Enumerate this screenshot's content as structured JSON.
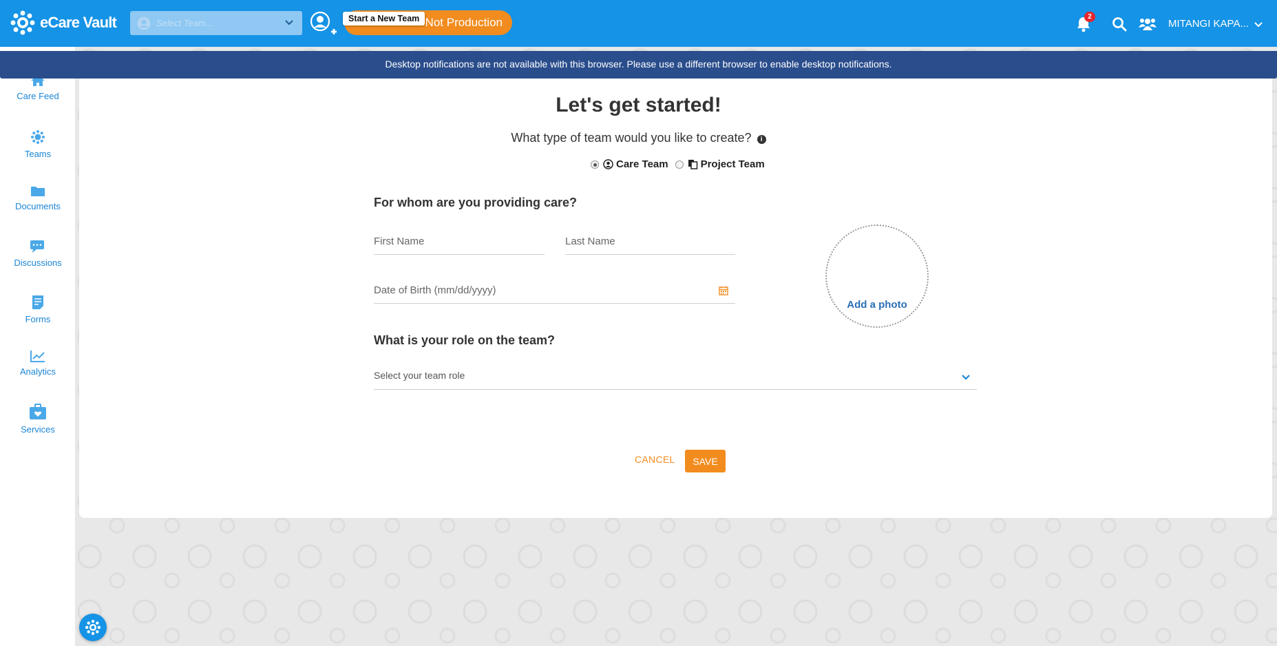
{
  "app": {
    "brand_name": "eCare Vault",
    "team_select_placeholder": "Select Team...",
    "start_team_tooltip": "Start a New Team",
    "environment_label": "Not Production",
    "notifications_count": "2",
    "user_name": "MITANGI KAPA...",
    "colors": {
      "topbar": "#1593e6",
      "accent": "#f28c1e",
      "banner": "#2a4d8c",
      "nav": "#1b86d6"
    }
  },
  "banner": {
    "text": "Desktop notifications are not available with this browser. Please use a different browser to enable desktop notifications."
  },
  "sidebar": {
    "items": [
      {
        "label": "Care Feed",
        "icon": "home-icon"
      },
      {
        "label": "Teams",
        "icon": "teams-icon"
      },
      {
        "label": "Documents",
        "icon": "folder-icon"
      },
      {
        "label": "Discussions",
        "icon": "chat-icon"
      },
      {
        "label": "Forms",
        "icon": "form-icon"
      },
      {
        "label": "Analytics",
        "icon": "chart-icon"
      },
      {
        "label": "Services",
        "icon": "briefcase-icon"
      }
    ]
  },
  "form": {
    "title": "Let's get started!",
    "team_type_question": "What type of team would you like to create?",
    "team_types": [
      {
        "label": "Care Team",
        "selected": true
      },
      {
        "label": "Project Team",
        "selected": false
      }
    ],
    "care_question": "For whom are you providing care?",
    "first_name_placeholder": "First Name",
    "last_name_placeholder": "Last Name",
    "dob_placeholder": "Date of Birth (mm/dd/yyyy)",
    "add_photo_label": "Add a photo",
    "role_question": "What is your role on the team?",
    "role_placeholder": "Select your team role",
    "cancel_label": "CANCEL",
    "save_label": "SAVE"
  }
}
